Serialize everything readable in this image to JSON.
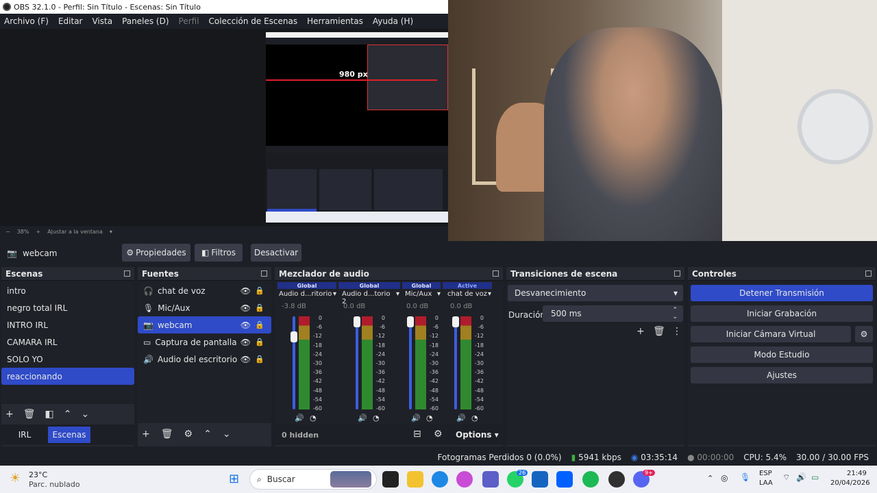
{
  "window": {
    "title": "OBS 32.1.0 - Perfil: Sin Título - Escenas: Sin Título"
  },
  "menu": [
    "Archivo (F)",
    "Editar",
    "Vista",
    "Paneles (D)",
    "Perfil",
    "Colección de Escenas",
    "Herramientas",
    "Ayuda (H)"
  ],
  "preview": {
    "zoom": "38%",
    "fit": "Ajustar a la ventana",
    "measure": "980 px"
  },
  "source_bar": {
    "selected": "webcam",
    "props": "Propiedades",
    "filters": "Filtros",
    "deactivate": "Desactivar"
  },
  "scenes": {
    "title": "Escenas",
    "items": [
      "intro",
      "negro total IRL",
      "INTRO IRL",
      "CAMARA IRL",
      "SOLO YO",
      "reaccionando"
    ],
    "tabs": [
      "IRL",
      "Escenas"
    ]
  },
  "sources": {
    "title": "Fuentes",
    "items": [
      "chat de voz",
      "Mic/Aux",
      "webcam",
      "Captura de pantalla",
      "Audio del escritorio"
    ]
  },
  "mixer": {
    "title": "Mezclador de audio",
    "channels": [
      {
        "tag": "Global",
        "name": "Audio d...ritorio",
        "db": "-3.8 dB",
        "level": 0.82
      },
      {
        "tag": "Global",
        "name": "Audio d...torio 2",
        "db": "0.0 dB",
        "level": 1.0
      },
      {
        "tag": "Global",
        "name": "Mic/Aux",
        "db": "0.0 dB",
        "level": 1.0
      },
      {
        "tag": "Active",
        "name": "chat de voz",
        "db": "0.0 dB",
        "level": 1.0
      }
    ],
    "scale": [
      "0",
      "-6",
      "-12",
      "-18",
      "-24",
      "-30",
      "-36",
      "-42",
      "-48",
      "-54",
      "-60"
    ],
    "hidden": "0 hidden",
    "options": "Options"
  },
  "transitions": {
    "title": "Transiciones de escena",
    "type": "Desvanecimiento",
    "duration_label": "Duración",
    "duration": "500 ms"
  },
  "controls": {
    "title": "Controles",
    "stream": "Detener Transmisión",
    "record": "Iniciar Grabación",
    "vcam": "Iniciar Cámara Virtual",
    "studio": "Modo Estudio",
    "settings": "Ajustes"
  },
  "status": {
    "dropped": "Fotogramas Perdidos 0 (0.0%)",
    "kbps": "5941 kbps",
    "stream_time": "03:35:14",
    "rec_time": "00:00:00",
    "cpu": "CPU: 5.4%",
    "fps": "30.00 / 30.00 FPS"
  },
  "taskbar": {
    "temp": "23°C",
    "weather": "Parc. nublado",
    "search": "Buscar",
    "lang1": "ESP",
    "lang2": "LAA",
    "time": "21:49",
    "date": "20/04/2026",
    "badge1": "26",
    "badge2": "9+"
  },
  "colors": {
    "accent": "#2f4bc8",
    "bg": "#1d1f26",
    "dock": "#272a33"
  }
}
